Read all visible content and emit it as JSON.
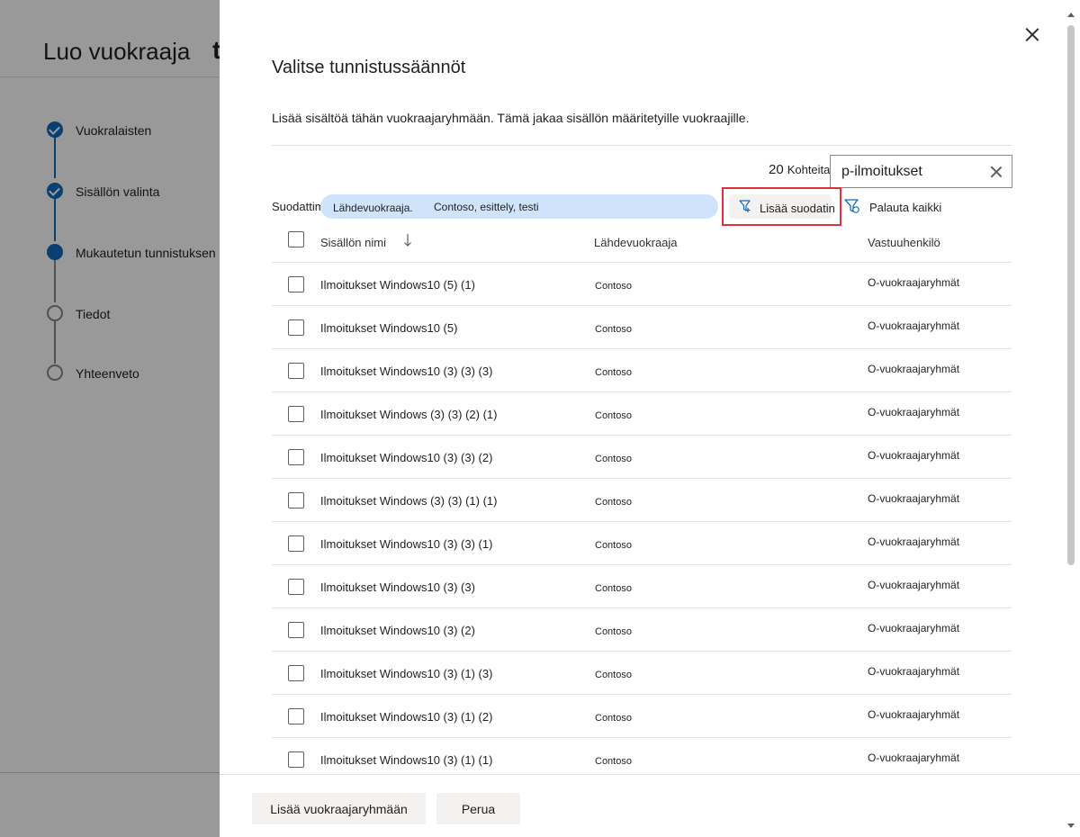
{
  "wizard": {
    "title": "Luo vuokraaja",
    "title_extra": "t",
    "steps": [
      {
        "label": "Vuokralaisten",
        "state": "done"
      },
      {
        "label": "Sisällön valinta",
        "state": "done"
      },
      {
        "label": "Mukautetun tunnistuksen suorittaminen",
        "state": "current"
      },
      {
        "label": "Tiedot",
        "state": "todo"
      },
      {
        "label": "Yhteenveto",
        "state": "todo"
      }
    ]
  },
  "panel": {
    "title": "Valitse tunnistussäännöt",
    "description": "Lisää sisältöä tähän vuokraajaryhmään. Tämä jakaa sisällön määritetyille vuokraajille.",
    "count_number": "20",
    "count_label": "Kohteita",
    "search": {
      "value": "p-ilmoitukset"
    },
    "filters_label": "Suodattimet",
    "filter_pill": {
      "key": "Lähdevuokraaja.",
      "value": "Contoso, esittely, testi"
    },
    "add_filter_label": "Lisää suodatin",
    "reset_label": "Palauta kaikki",
    "table": {
      "columns": [
        "Sisällön nimi",
        "Lähdevuokraaja",
        "Vastuuhenkilö"
      ],
      "rows": [
        {
          "name": "Ilmoitukset Windows10 (5) (1)",
          "source": "Contoso",
          "owner": "O-vuokraajaryhmät"
        },
        {
          "name": "Ilmoitukset Windows10 (5)",
          "source": "Contoso",
          "owner": "O-vuokraajaryhmät"
        },
        {
          "name": "Ilmoitukset Windows10 (3) (3) (3)",
          "source": "Contoso",
          "owner": "O-vuokraajaryhmät"
        },
        {
          "name": "Ilmoitukset Windows (3) (3) (2) (1)",
          "source": "Contoso",
          "owner": "O-vuokraajaryhmät"
        },
        {
          "name": "Ilmoitukset Windows10 (3) (3) (2)",
          "source": "Contoso",
          "owner": "O-vuokraajaryhmät"
        },
        {
          "name": "Ilmoitukset Windows (3) (3) (1) (1)",
          "source": "Contoso",
          "owner": "O-vuokraajaryhmät"
        },
        {
          "name": "Ilmoitukset Windows10 (3) (3) (1)",
          "source": "Contoso",
          "owner": "O-vuokraajaryhmät"
        },
        {
          "name": "Ilmoitukset Windows10 (3) (3)",
          "source": "Contoso",
          "owner": "O-vuokraajaryhmät"
        },
        {
          "name": "Ilmoitukset Windows10 (3) (2)",
          "source": "Contoso",
          "owner": "O-vuokraajaryhmät"
        },
        {
          "name": "Ilmoitukset Windows10 (3) (1) (3)",
          "source": "Contoso",
          "owner": "O-vuokraajaryhmät"
        },
        {
          "name": "Ilmoitukset Windows10 (3) (1) (2)",
          "source": "Contoso",
          "owner": "O-vuokraajaryhmät"
        },
        {
          "name": "Ilmoitukset Windows10 (3) (1) (1)",
          "source": "Contoso",
          "owner": "O-vuokraajaryhmät"
        }
      ]
    },
    "buttons": {
      "primary": "Lisää vuokraajaryhmään",
      "cancel": "Perua"
    }
  },
  "colors": {
    "accent": "#0f6cbd",
    "pill": "#cfe4fa",
    "highlight": "#e0313b"
  },
  "icons": [
    "check-icon",
    "close-icon",
    "filter-add-icon",
    "filter-reset-icon",
    "sort-down-icon"
  ]
}
